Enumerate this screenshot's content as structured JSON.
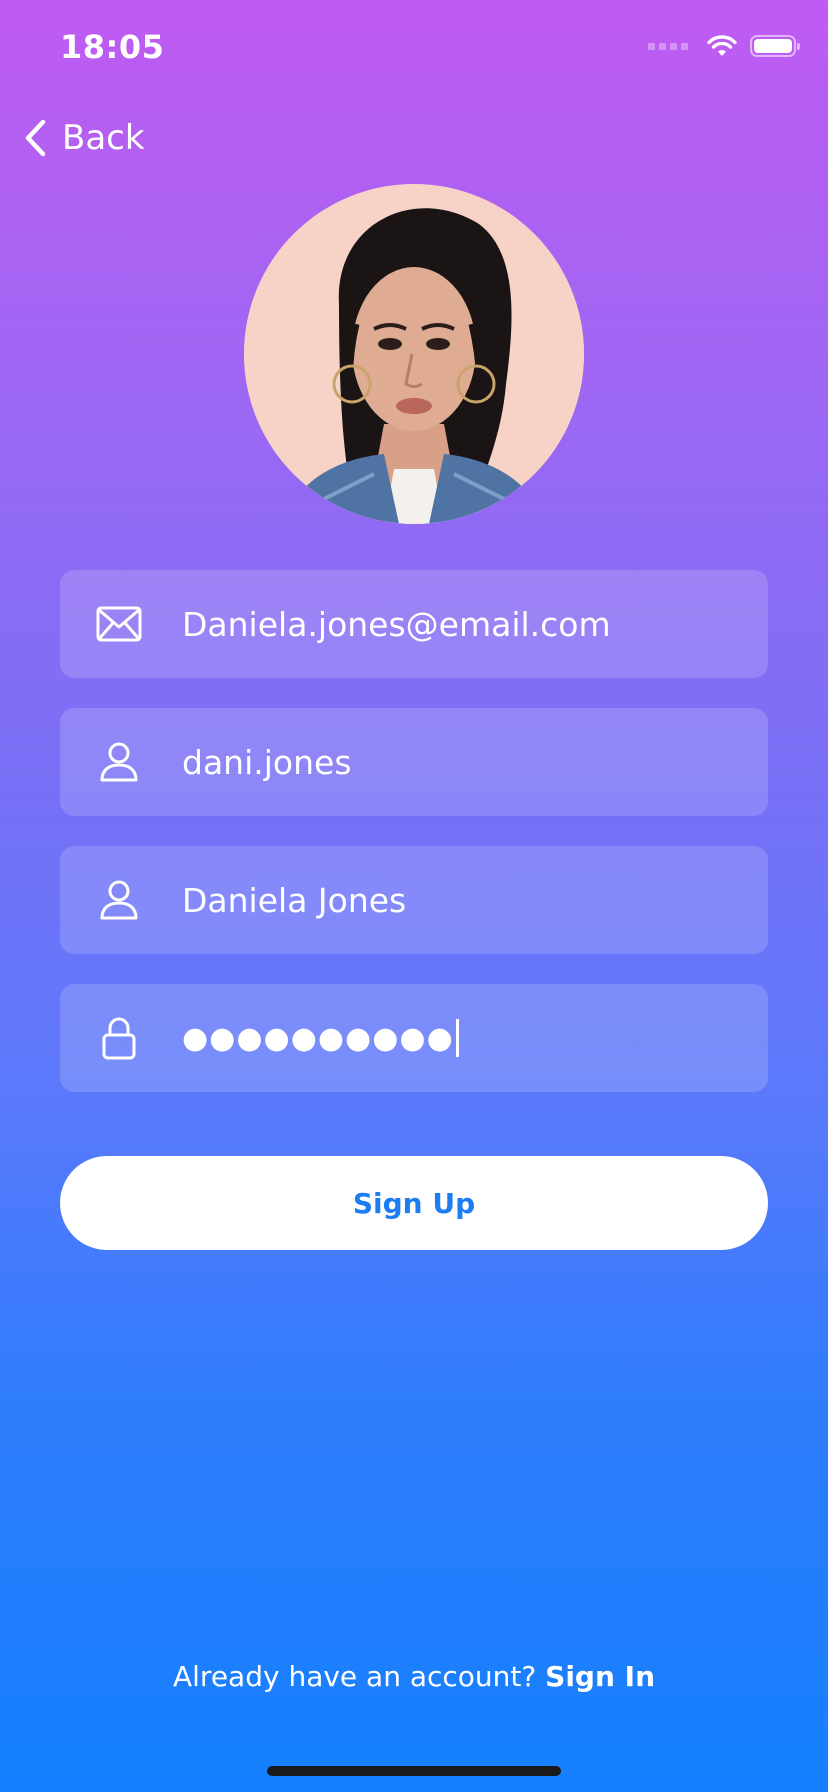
{
  "status_bar": {
    "time": "18:05",
    "icons": [
      "signal-icon",
      "wifi-icon",
      "battery-icon"
    ]
  },
  "nav": {
    "back_label": "Back",
    "back_icon": "chevron-left-icon"
  },
  "avatar": {
    "icon": "profile-photo"
  },
  "form": {
    "email": {
      "icon": "envelope-icon",
      "value": "Daniela.jones@email.com"
    },
    "username": {
      "icon": "person-icon",
      "value": "dani.jones"
    },
    "full_name": {
      "icon": "person-icon",
      "value": "Daniela Jones"
    },
    "password": {
      "icon": "lock-icon",
      "value": "●●●●●●●●●●"
    }
  },
  "signup_button_label": "Sign Up",
  "footer": {
    "prompt": "Already have an account?",
    "link_label": "Sign In"
  },
  "colors": {
    "gradient_top": "#c05af2",
    "gradient_bottom": "#1480ff",
    "button_text": "#1c7cf1"
  }
}
